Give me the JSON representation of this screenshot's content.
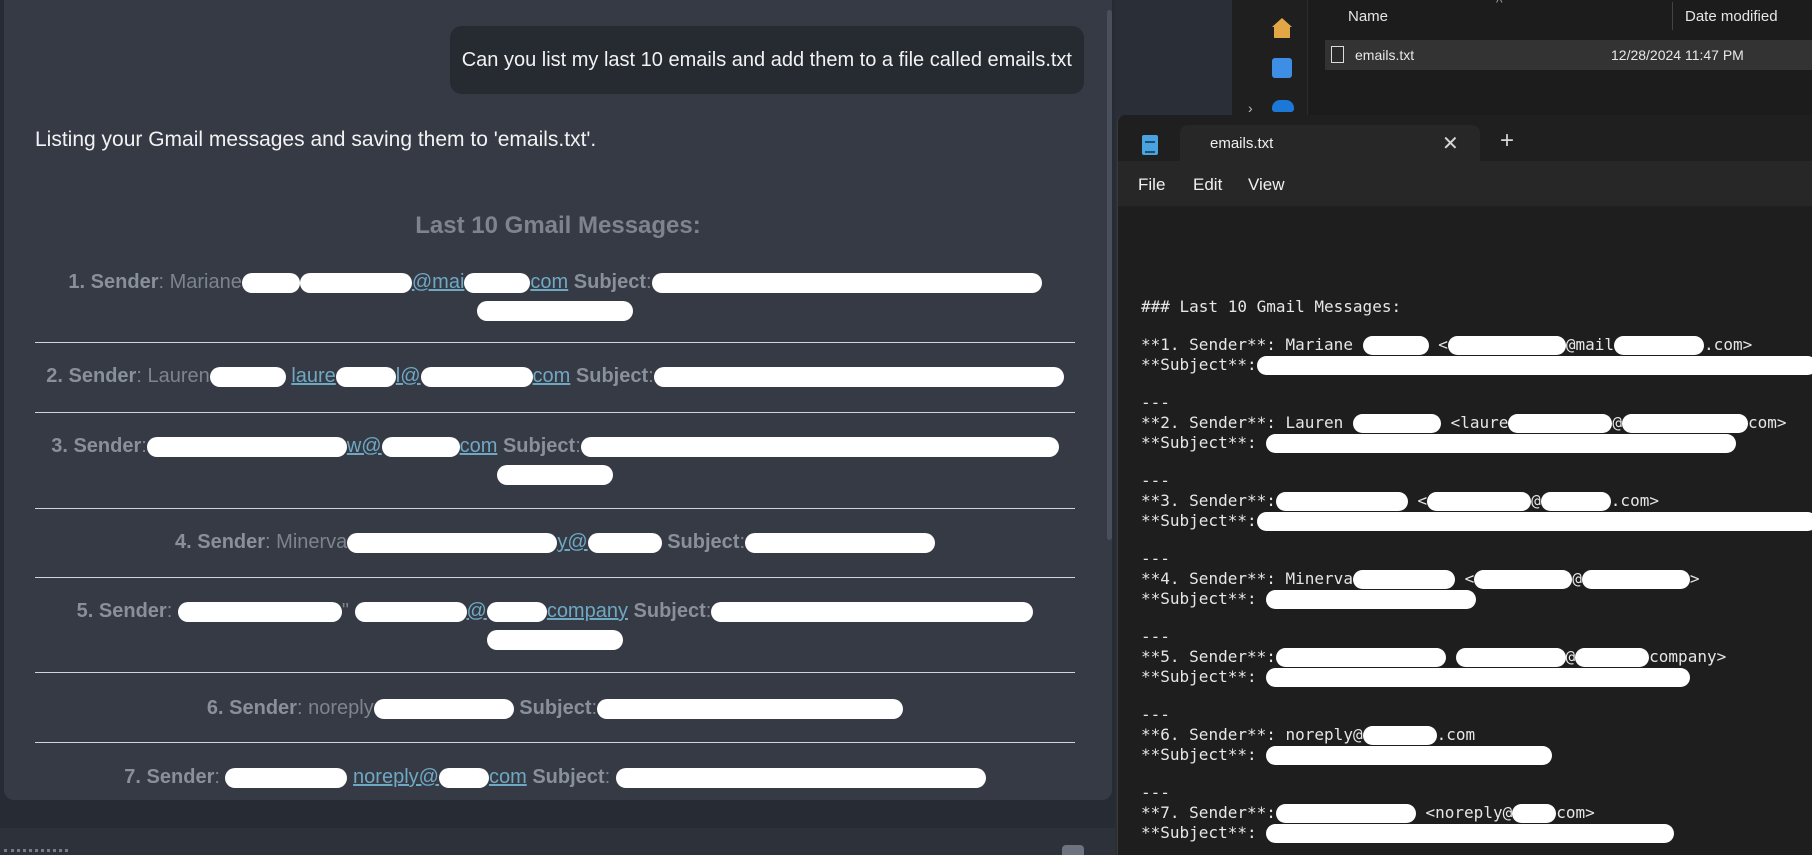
{
  "chat": {
    "user_message": "Can you list my last 10 emails and add them to a file called emails.txt",
    "assistant_text": "Listing your Gmail messages and saving them to 'emails.txt'.",
    "heading": "Last 10 Gmail Messages:",
    "sender_label": "Sender",
    "subject_label": "Subject",
    "items": [
      {
        "num": "1.",
        "name": "Mariane",
        "link": "@mai",
        "link_end": "com"
      },
      {
        "num": "2.",
        "name": "Lauren",
        "link": "laure",
        "link_mid": "l@",
        "link_end": "com"
      },
      {
        "num": "3.",
        "name": "",
        "link": "w@",
        "link_end": "com"
      },
      {
        "num": "4.",
        "name": "Minerva",
        "link": "y@",
        "link_end": ""
      },
      {
        "num": "5.",
        "name": "\"",
        "link": "@",
        "link_end": "company"
      },
      {
        "num": "6.",
        "name": "noreply",
        "link": "",
        "link_end": ""
      },
      {
        "num": "7.",
        "name": "",
        "link": "noreply@",
        "link_end": "com"
      }
    ]
  },
  "explorer": {
    "col_name": "Name",
    "col_date": "Date modified",
    "file_name": "emails.txt",
    "file_date": "12/28/2024 11:47 PM"
  },
  "notepad": {
    "tab_title": "emails.txt",
    "close_glyph": "✕",
    "newtab_glyph": "+",
    "menu": {
      "file": "File",
      "edit": "Edit",
      "view": "View"
    },
    "heading_line": "### Last 10 Gmail Messages:",
    "sender_prefix": "Sender**:",
    "subject_line": "**Subject**:",
    "separator": "---",
    "entries": [
      {
        "num": "**1.",
        "name": "Mariane",
        "addr_a": "<",
        "addr_b": "@mail",
        "addr_c": ".com>"
      },
      {
        "num": "**2.",
        "name": "Lauren",
        "addr_a": "<laure",
        "addr_b": "@",
        "addr_c": "com>"
      },
      {
        "num": "**3.",
        "name": "",
        "addr_a": "<",
        "addr_b": "@",
        "addr_c": ".com>"
      },
      {
        "num": "**4.",
        "name": "Minerva",
        "addr_a": "<",
        "addr_b": "@",
        "addr_c": ">"
      },
      {
        "num": "**5.",
        "name": "",
        "addr_a": "",
        "addr_b": "@",
        "addr_c": "company>"
      },
      {
        "num": "**6.",
        "name": "noreply@",
        "addr_a": "",
        "addr_b": "",
        "addr_c": ".com"
      },
      {
        "num": "**7.",
        "name": "",
        "addr_a": "<noreply@",
        "addr_b": "",
        "addr_c": "com>"
      }
    ]
  },
  "colors": {
    "link": "#6fa8c3",
    "accent_icon": "#4aa3df"
  },
  "icons": [
    "home-icon",
    "gallery-icon",
    "onedrive-icon",
    "file-icon",
    "notepad-icon",
    "close-icon",
    "plus-icon"
  ]
}
